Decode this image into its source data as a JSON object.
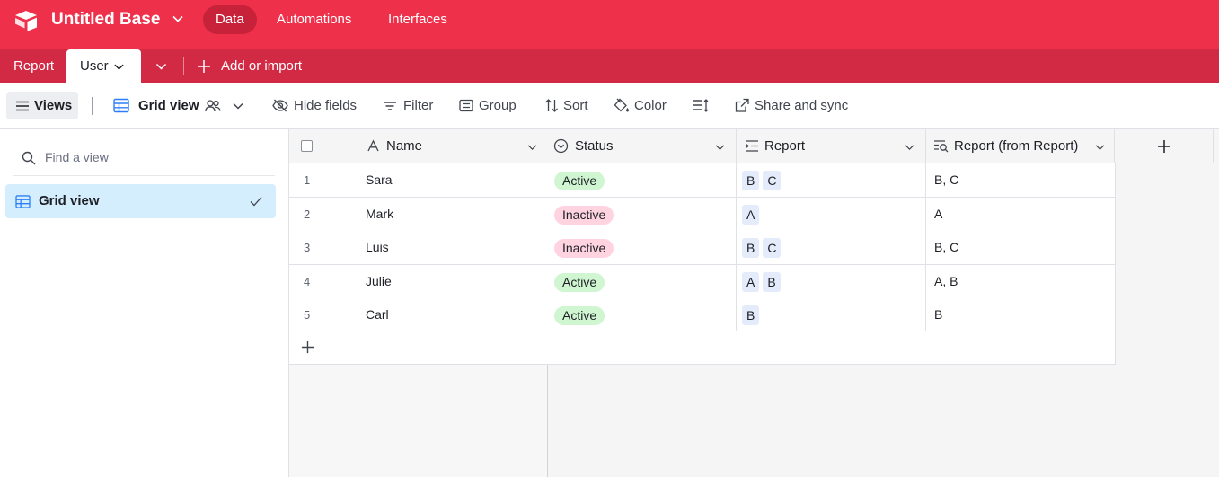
{
  "app": {
    "base_name": "Untitled Base",
    "nav": [
      "Data",
      "Automations",
      "Interfaces"
    ],
    "accent_color": "#ef304b"
  },
  "tables": {
    "tabs": [
      "Report",
      "User"
    ],
    "active_tab": "User",
    "add_or_import": "Add or import"
  },
  "toolbar": {
    "views": "Views",
    "view_name": "Grid view",
    "hide_fields": "Hide fields",
    "filter": "Filter",
    "group": "Group",
    "sort": "Sort",
    "color": "Color",
    "share_sync": "Share and sync"
  },
  "sidebar": {
    "search_placeholder": "Find a view",
    "views": [
      {
        "label": "Grid view",
        "selected": true
      }
    ]
  },
  "grid": {
    "columns": [
      "Name",
      "Status",
      "Report",
      "Report (from Report)"
    ],
    "rows": [
      {
        "num": "1",
        "name": "Sara",
        "status": "Active",
        "report": [
          "B",
          "C"
        ],
        "lookup": "B, C"
      },
      {
        "num": "2",
        "name": "Mark",
        "status": "Inactive",
        "report": [
          "A"
        ],
        "lookup": "A"
      },
      {
        "num": "3",
        "name": "Luis",
        "status": "Inactive",
        "report": [
          "B",
          "C"
        ],
        "lookup": "B, C"
      },
      {
        "num": "4",
        "name": "Julie",
        "status": "Active",
        "report": [
          "A",
          "B"
        ],
        "lookup": "A, B"
      },
      {
        "num": "5",
        "name": "Carl",
        "status": "Active",
        "report": [
          "B"
        ],
        "lookup": "B"
      }
    ]
  }
}
